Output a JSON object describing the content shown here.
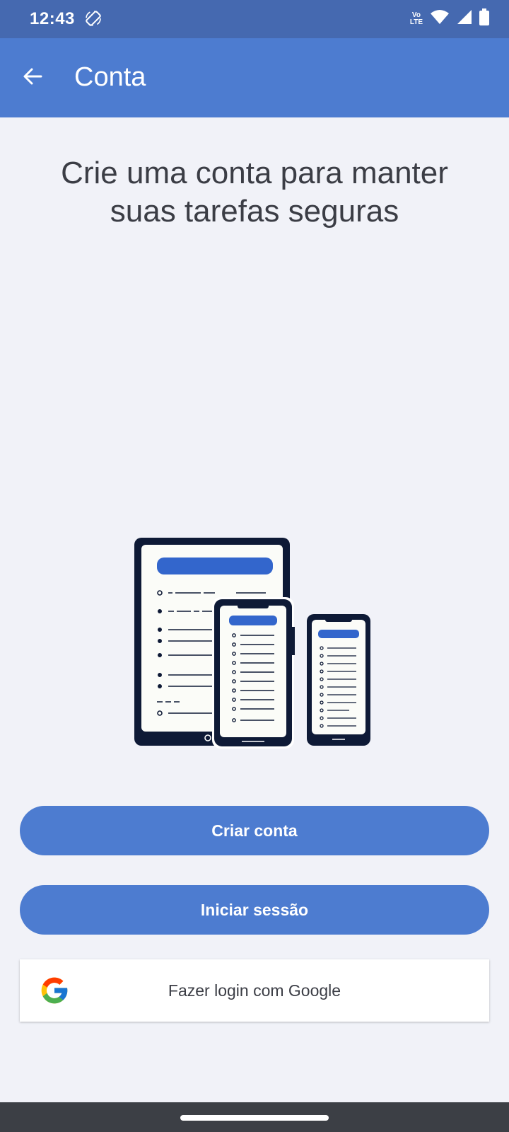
{
  "status_bar": {
    "time": "12:43",
    "network_label_top": "Vo",
    "network_label_bottom": "LTE",
    "icons": [
      "screen-rotation-icon",
      "volte-icon",
      "wifi-icon",
      "cellular-signal-icon",
      "battery-icon"
    ]
  },
  "app_bar": {
    "title": "Conta",
    "back_icon": "arrow-back-icon"
  },
  "main": {
    "headline_line1": "Crie uma conta para manter",
    "headline_line2": "suas tarefas seguras",
    "illustration": "tablet-and-phones-task-list-illustration"
  },
  "actions": {
    "create_account_label": "Criar conta",
    "sign_in_label": "Iniciar sessão",
    "google_login_label": "Fazer login com Google",
    "google_icon": "google-g-logo"
  },
  "colors": {
    "status_bar": "#4569b0",
    "app_bar": "#4d7cd0",
    "primary_button": "#4d7cd0",
    "background": "#f1f2f8",
    "device_frame": "#0e1a36",
    "text": "#3b3d45"
  }
}
